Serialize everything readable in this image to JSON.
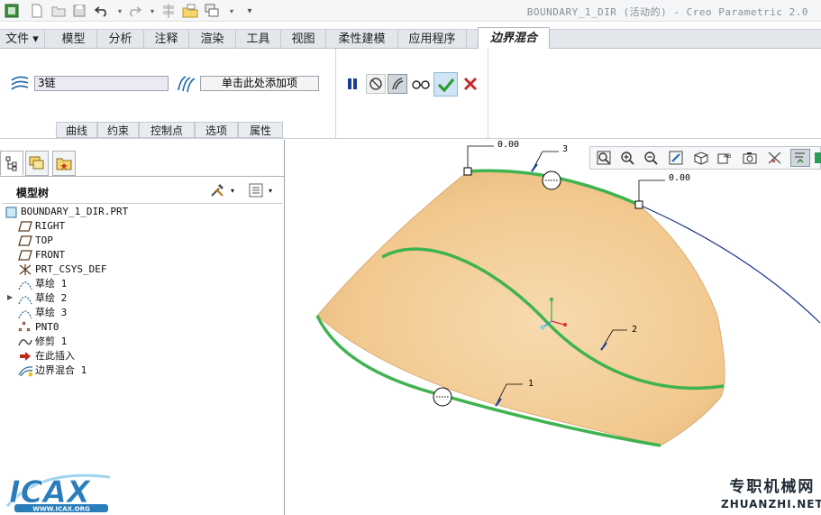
{
  "window": {
    "title": "BOUNDARY_1_DIR (活动的) - Creo Parametric 2.0"
  },
  "tabs": [
    {
      "label": "文件 ▾",
      "active": false
    },
    {
      "label": "模型",
      "active": false
    },
    {
      "label": "分析",
      "active": false
    },
    {
      "label": "注释",
      "active": false
    },
    {
      "label": "渲染",
      "active": false
    },
    {
      "label": "工具",
      "active": false
    },
    {
      "label": "视图",
      "active": false
    },
    {
      "label": "柔性建模",
      "active": false
    },
    {
      "label": "应用程序",
      "active": false
    },
    {
      "label": "边界混合",
      "active": true
    }
  ],
  "dashboard": {
    "first_direction_value": "3链",
    "second_direction_placeholder": "单击此处添加项",
    "panels": [
      "曲线",
      "约束",
      "控制点",
      "选项",
      "属性"
    ]
  },
  "model_tree": {
    "tab_icons": [
      "model-tree-icon",
      "layer-icon",
      "favorites-icon"
    ],
    "title": "模型树",
    "items": [
      {
        "label": "BOUNDARY_1_DIR.PRT",
        "icon": "part-icon",
        "expandable": false
      },
      {
        "label": "RIGHT",
        "icon": "datum-plane-icon",
        "expandable": false
      },
      {
        "label": "TOP",
        "icon": "datum-plane-icon",
        "expandable": false
      },
      {
        "label": "FRONT",
        "icon": "datum-plane-icon",
        "expandable": false
      },
      {
        "label": "PRT_CSYS_DEF",
        "icon": "csys-icon",
        "expandable": false
      },
      {
        "label": "草绘 1",
        "icon": "sketch-icon",
        "expandable": false
      },
      {
        "label": "草绘 2",
        "icon": "sketch-icon",
        "expandable": true
      },
      {
        "label": "草绘 3",
        "icon": "sketch-icon",
        "expandable": false
      },
      {
        "label": "PNT0",
        "icon": "datum-point-icon",
        "expandable": false
      },
      {
        "label": "修剪 1",
        "icon": "trim-icon",
        "expandable": false
      },
      {
        "label": "在此插入",
        "icon": "insert-here-icon",
        "expandable": false
      },
      {
        "label": "边界混合 1",
        "icon": "boundary-blend-icon",
        "expandable": false
      }
    ]
  },
  "graphics": {
    "annotations": {
      "tension_top_left": "0.00",
      "tension_top_right": "0.00",
      "curve_label_top": "3",
      "curve_label_middle": "2",
      "curve_label_bottom": "1"
    },
    "colors": {
      "surface": "#f2c98f",
      "chain": "#3fb34f",
      "curve": "#1a2f8c",
      "accept": "#2a9d2a",
      "cancel": "#c62828"
    }
  },
  "watermarks": {
    "logo_text": "ICAX",
    "logo_url_text": "WWW.ICAX.ORG",
    "right_cn": "专职机械网",
    "right_en": "ZHUANZHI.NET"
  }
}
